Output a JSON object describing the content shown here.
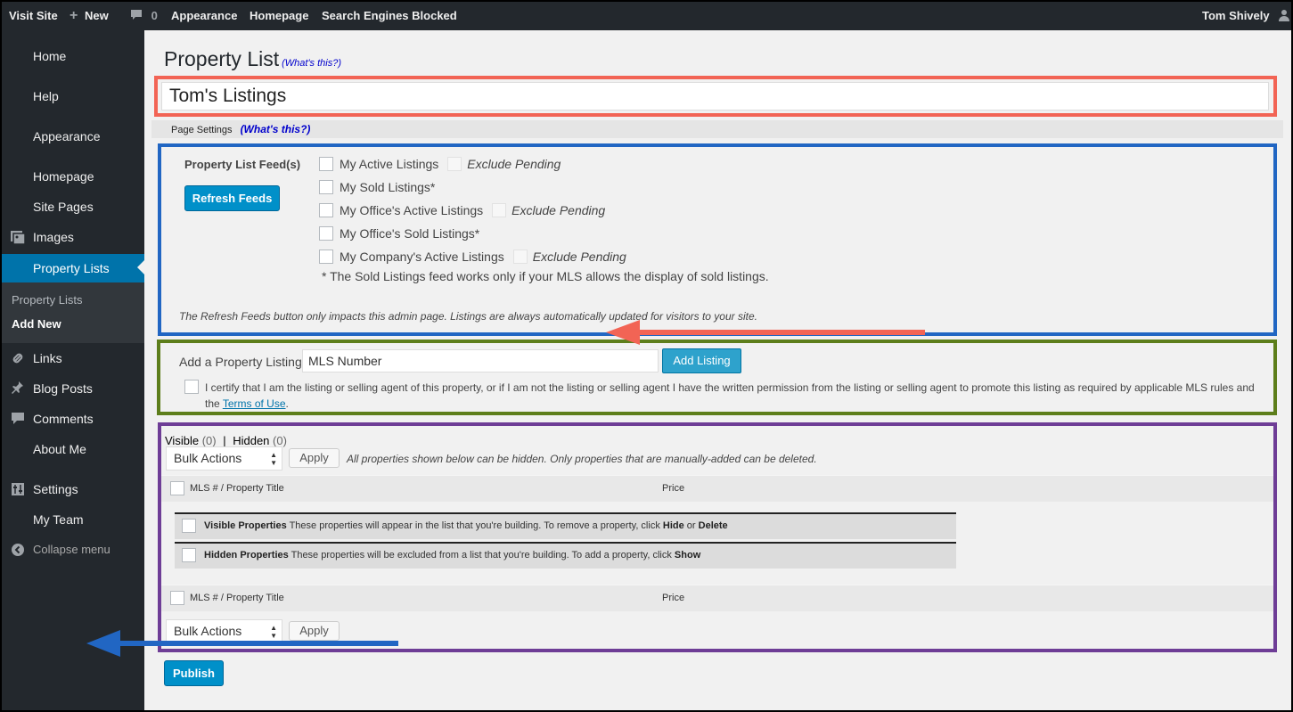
{
  "adminbar": {
    "visit_site": "Visit Site",
    "new_icon": "plus-icon",
    "new_label": "New",
    "comments_icon": "comment-bubble-icon",
    "comments_count": "0",
    "appearance": "Appearance",
    "homepage": "Homepage",
    "search_engines": "Search Engines Blocked",
    "user_name": "Tom Shively",
    "user_icon": "user-icon"
  },
  "sidebar": {
    "items": [
      {
        "label": "Home"
      },
      {
        "label": "Help"
      },
      {
        "label": "Appearance"
      },
      {
        "label": "Homepage"
      },
      {
        "label": "Site Pages"
      },
      {
        "label": "Images",
        "icon": "images-icon"
      },
      {
        "label": "Property Lists",
        "current": true
      },
      {
        "label": "Links",
        "icon": "link-icon"
      },
      {
        "label": "Blog Posts",
        "icon": "pin-icon"
      },
      {
        "label": "Comments",
        "icon": "comment-icon"
      },
      {
        "label": "About Me"
      },
      {
        "label": "Settings",
        "icon": "settings-icon"
      },
      {
        "label": "My Team"
      }
    ],
    "submenu": [
      "Property Lists",
      "Add New"
    ],
    "collapse_label": "Collapse menu",
    "collapse_icon": "collapse-icon"
  },
  "page": {
    "title": "Property List",
    "whats_this": "(What's this?)",
    "list_title": "Tom's Listings",
    "page_settings": "Page Settings",
    "page_settings_whats": "(What's this?)"
  },
  "feeds": {
    "label": "Property List Feed(s)",
    "refresh_button": "Refresh Feeds",
    "items": [
      {
        "label": "My Active Listings",
        "pending": "Exclude Pending"
      },
      {
        "label": "My Sold Listings*"
      },
      {
        "label": "My Office's Active Listings",
        "pending": "Exclude Pending"
      },
      {
        "label": "My Office's Sold Listings*"
      },
      {
        "label": "My Company's Active Listings",
        "pending": "Exclude Pending"
      }
    ],
    "sold_note": "* The Sold Listings feed works only if your MLS allows the display of sold listings.",
    "refresh_note": "The Refresh Feeds button only impacts this admin page. Listings are always automatically updated for visitors to your site."
  },
  "add_listing": {
    "label": "Add a Property Listing",
    "input_value": "MLS Number",
    "button": "Add Listing",
    "certify_text": "I certify that I am the listing or selling agent of this property, or if I am not the listing or selling agent I have the written permission from the listing or selling agent to promote this listing as required by applicable MLS rules and the ",
    "terms_link": "Terms of Use",
    "certify_end": "."
  },
  "properties": {
    "visible_label": "Visible",
    "visible_count": "(0)",
    "separator": "|",
    "hidden_label": "Hidden",
    "hidden_count": "(0)",
    "bulk_actions": "Bulk Actions",
    "apply": "Apply",
    "bulk_note": "All properties shown below can be hidden. Only properties that are manually-added can be deleted.",
    "col_title": "MLS # / Property Title",
    "col_price": "Price",
    "visible_group_title": "Visible Properties",
    "visible_group_text": " These properties will appear in the list that you're building. To remove a property, click ",
    "hide": "Hide",
    "or": " or ",
    "delete": "Delete",
    "hidden_group_title": "Hidden Properties",
    "hidden_group_text": " These properties will be excluded from a list that you're building. To add a property, click ",
    "show": "Show"
  },
  "publish": "Publish",
  "colors": {
    "admin_dark": "#23282d",
    "accent": "#0073aa",
    "red_annotation": "#f26455",
    "blue_annotation": "#2166c3",
    "green_annotation": "#5d7e1b",
    "purple_annotation": "#6e3d96"
  }
}
